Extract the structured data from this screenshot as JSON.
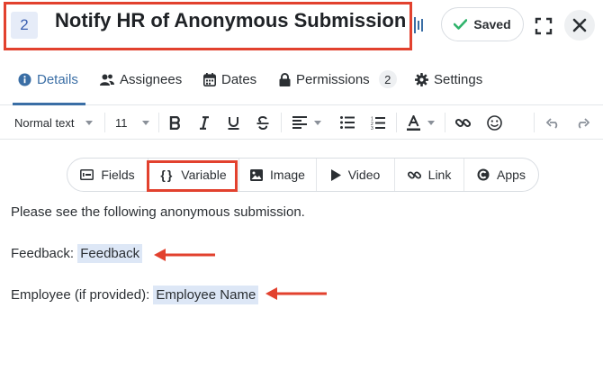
{
  "header": {
    "step_number": "2",
    "title": "Notify HR of Anonymous Submission",
    "saved_label": "Saved"
  },
  "tabs": [
    {
      "label": "Details",
      "icon": "info-icon",
      "active": true
    },
    {
      "label": "Assignees",
      "icon": "users-icon",
      "active": false
    },
    {
      "label": "Dates",
      "icon": "calendar-icon",
      "active": false
    },
    {
      "label": "Permissions",
      "icon": "lock-icon",
      "active": false,
      "count": "2"
    },
    {
      "label": "Settings",
      "icon": "gear-icon",
      "active": false
    }
  ],
  "toolbar": {
    "text_style": "Normal text",
    "font_size": "11"
  },
  "insert_bar": [
    {
      "label": "Fields",
      "icon": "fields-icon"
    },
    {
      "label": "Variable",
      "icon": "braces-icon"
    },
    {
      "label": "Image",
      "icon": "image-icon"
    },
    {
      "label": "Video",
      "icon": "play-icon"
    },
    {
      "label": "Link",
      "icon": "link-icon"
    },
    {
      "label": "Apps",
      "icon": "apps-icon"
    }
  ],
  "content": {
    "intro": "Please see the following anonymous submission.",
    "feedback_label": "Feedback:",
    "feedback_variable": "Feedback",
    "employee_label": "Employee (if provided):",
    "employee_variable": "Employee Name"
  },
  "colors": {
    "accent": "#3a6ea5",
    "highlight_border": "#e2412e",
    "variable_chip": "#dde7f6",
    "saved_check": "#2fb36b"
  }
}
